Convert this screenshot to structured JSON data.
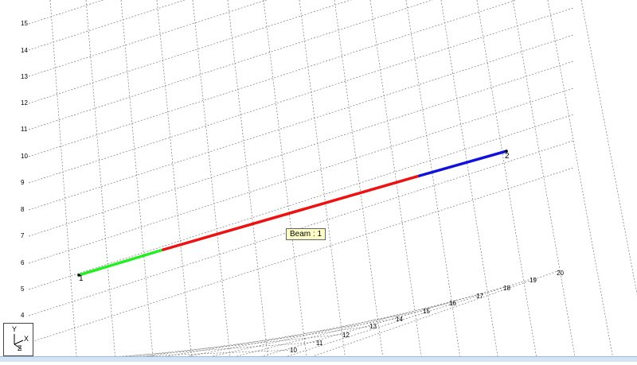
{
  "viewport": {
    "y_ticks": [
      "15",
      "14",
      "13",
      "12",
      "11",
      "10",
      "9",
      "8",
      "7",
      "6",
      "5",
      "4"
    ],
    "z_ticks": [
      "10",
      "11",
      "12",
      "13",
      "14",
      "15",
      "16",
      "17",
      "18",
      "19",
      "20"
    ],
    "nodes": [
      "1",
      "2"
    ],
    "segment_colors": [
      "#22ee22",
      "#ee1111",
      "#1111dd"
    ]
  },
  "tooltip": {
    "text": "Beam : 1"
  },
  "axis_triad": {
    "y": "Y",
    "x": "X",
    "z": "Z"
  }
}
